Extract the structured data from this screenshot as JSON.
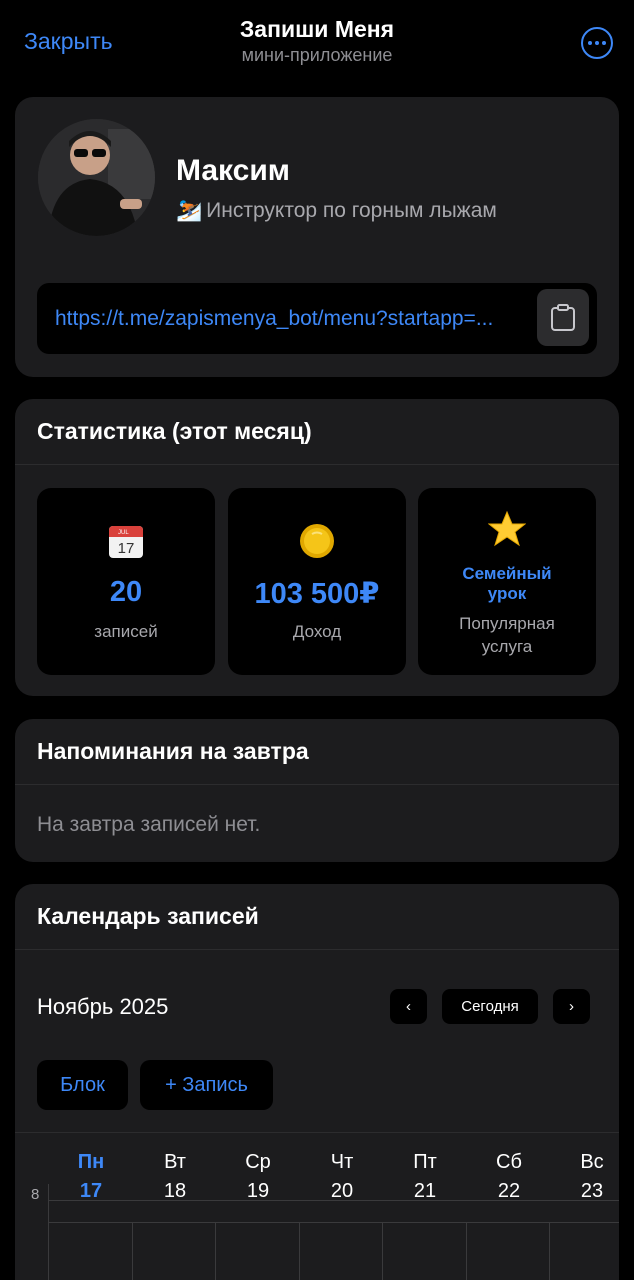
{
  "topbar": {
    "close_label": "Закрыть",
    "title": "Запиши Меня",
    "subtitle": "мини-приложение"
  },
  "profile": {
    "name": "Максим",
    "role_emoji": "⛷️",
    "role": "Инструктор по горным лыжам",
    "link": "https://t.me/zapismenya_bot/menu?startapp=..."
  },
  "stats": {
    "title": "Статистика (этот месяц)",
    "items": [
      {
        "icon": "calendar-icon",
        "value": "20",
        "label": "записей"
      },
      {
        "icon": "coin-icon",
        "value": "103 500₽",
        "label": "Доход"
      },
      {
        "icon": "star-icon",
        "value": "Семейный урок",
        "label": "Популярная услуга"
      }
    ]
  },
  "reminders": {
    "title": "Напоминания на завтра",
    "empty": "На завтра записей нет."
  },
  "calendar": {
    "title": "Календарь записей",
    "month": "Ноябрь 2025",
    "prev": "‹",
    "today": "Сегодня",
    "next": "›",
    "block_label": "Блок",
    "add_label": "+ Запись",
    "hour": "8",
    "days": [
      {
        "name": "Пн",
        "date": "17"
      },
      {
        "name": "Вт",
        "date": "18"
      },
      {
        "name": "Ср",
        "date": "19"
      },
      {
        "name": "Чт",
        "date": "20"
      },
      {
        "name": "Пт",
        "date": "21"
      },
      {
        "name": "Сб",
        "date": "22"
      },
      {
        "name": "Вс",
        "date": "23"
      }
    ]
  },
  "colors": {
    "accent": "#3e88f7",
    "card": "#1c1c1e",
    "background": "#000000"
  }
}
